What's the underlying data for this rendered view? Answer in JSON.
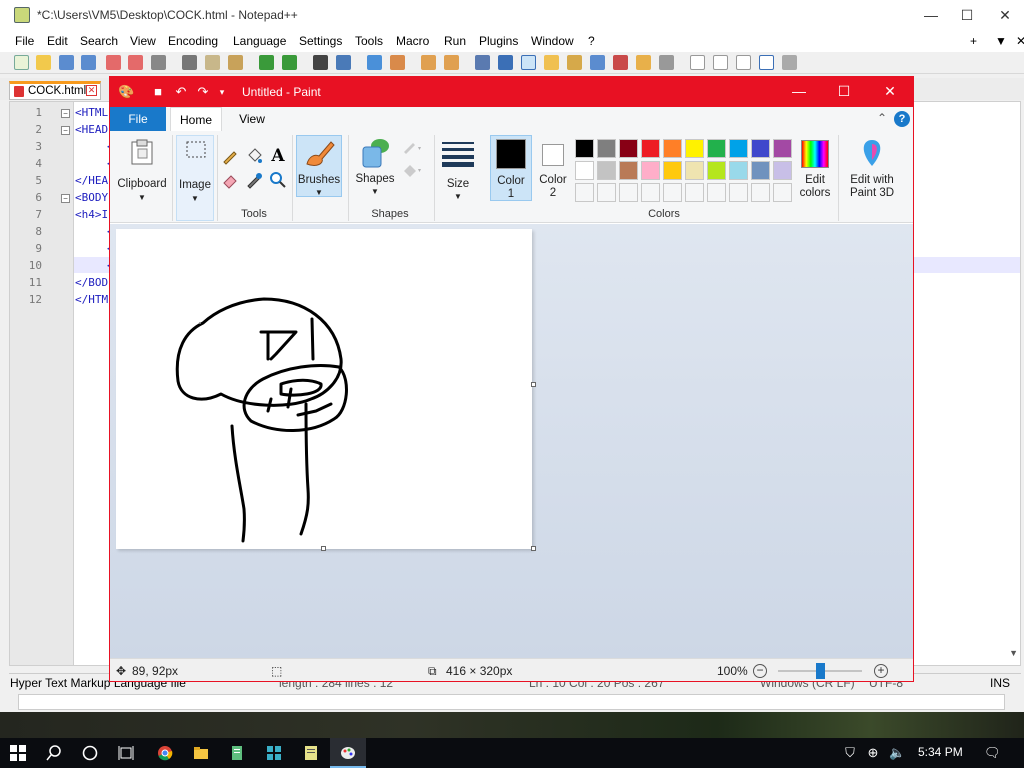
{
  "npp": {
    "title": "*C:\\Users\\VM5\\Desktop\\COCK.html - Notepad++",
    "menu": [
      "File",
      "Edit",
      "Search",
      "View",
      "Encoding",
      "Language",
      "Settings",
      "Tools",
      "Macro",
      "Run",
      "Plugins",
      "Window",
      "?"
    ],
    "menu_right": [
      "+",
      "▼",
      "✕"
    ],
    "tab_label": "COCK.html",
    "lines": [
      {
        "num": "1",
        "code": "<HTML"
      },
      {
        "num": "2",
        "code": "<HEAD"
      },
      {
        "num": "3",
        "code": "<"
      },
      {
        "num": "4",
        "code": "<"
      },
      {
        "num": "5",
        "code": "</HEA"
      },
      {
        "num": "6",
        "code": "<BODY"
      },
      {
        "num": "7",
        "code": "<h4>I"
      },
      {
        "num": "8",
        "code": "<"
      },
      {
        "num": "9",
        "code": "<"
      },
      {
        "num": "10",
        "code": "<"
      },
      {
        "num": "11",
        "code": "</BOD"
      },
      {
        "num": "12",
        "code": "</HTM"
      }
    ],
    "status": {
      "language": "Hyper Text Markup Language file",
      "length": "length : 284    lines : 12",
      "position": "Ln : 10    Col : 20    Pos : 267",
      "eol": "Windows (CR LF)",
      "encoding": "UTF-8",
      "mode": "INS"
    }
  },
  "paint": {
    "title": "Untitled - Paint",
    "tabs": {
      "file": "File",
      "home": "Home",
      "view": "View"
    },
    "ribbon": {
      "clipboard": "Clipboard",
      "image": "Image",
      "tools_group": "Tools",
      "brushes": "Brushes",
      "shapes": "Shapes",
      "shapes_group": "Shapes",
      "size": "Size",
      "color1": "Color\n1",
      "color2": "Color\n2",
      "colors_group": "Colors",
      "edit_colors": "Edit\ncolors",
      "paint3d": "Edit with\nPaint 3D"
    },
    "palette_row1": [
      "#000000",
      "#7f7f7f",
      "#880015",
      "#ed1c24",
      "#ff7f27",
      "#fff200",
      "#22b14c",
      "#00a2e8",
      "#3f48cc",
      "#a349a4"
    ],
    "palette_row2": [
      "#ffffff",
      "#c3c3c3",
      "#b97a57",
      "#ffaec9",
      "#ffc90e",
      "#efe4b0",
      "#b5e61d",
      "#99d9ea",
      "#7092be",
      "#c8bfe7"
    ],
    "color1_value": "#000000",
    "color2_value": "#ffffff",
    "status": {
      "cursor_pos": "89, 92px",
      "canvas_size": "416 × 320px",
      "zoom": "100%"
    }
  },
  "taskbar": {
    "time": "5:34 PM"
  }
}
